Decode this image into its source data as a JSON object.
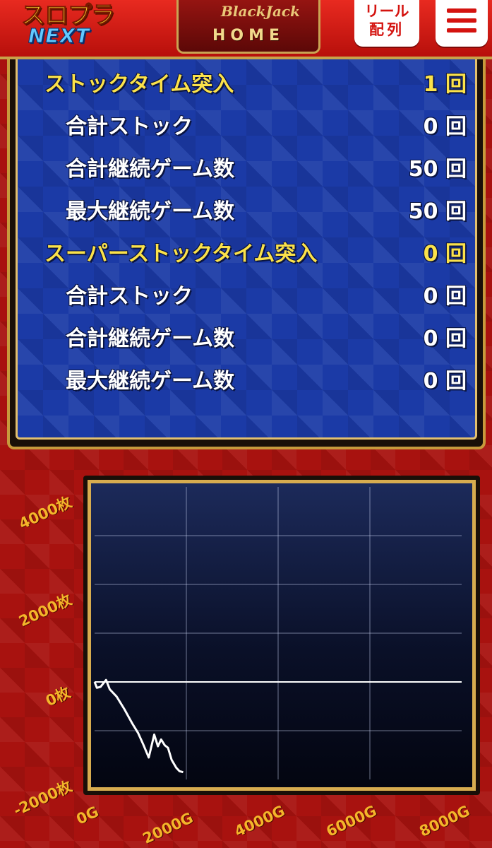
{
  "header": {
    "logo": {
      "top": "スロプラ",
      "bottom": "NEXT"
    },
    "home": {
      "emblem": "BlackJack",
      "label": "HOME"
    },
    "reel_button": {
      "line1": "リール",
      "line2": "配列"
    },
    "menu_icon": "hamburger-menu-icon"
  },
  "stats": [
    {
      "label": "ストックタイム突入",
      "value": "1 回",
      "level": "main"
    },
    {
      "label": "合計ストック",
      "value": "0 回",
      "level": "sub"
    },
    {
      "label": "合計継続ゲーム数",
      "value": "50 回",
      "level": "sub"
    },
    {
      "label": "最大継続ゲーム数",
      "value": "50 回",
      "level": "sub"
    },
    {
      "label": "スーパーストックタイム突入",
      "value": "0 回",
      "level": "main"
    },
    {
      "label": "合計ストック",
      "value": "0 回",
      "level": "sub"
    },
    {
      "label": "合計継続ゲーム数",
      "value": "0 回",
      "level": "sub"
    },
    {
      "label": "最大継続ゲーム数",
      "value": "0 回",
      "level": "sub"
    }
  ],
  "colors": {
    "header_red": "#d41a13",
    "panel_blue": "#1b3aa6",
    "gold": "#d7ac4f",
    "main_text": "#fbe24a",
    "axis_label": "#f4b52a"
  },
  "chart_data": {
    "type": "line",
    "y_tick_labels": [
      "4000枚",
      "2000枚",
      "0枚",
      "-2000枚"
    ],
    "x_tick_labels": [
      "0G",
      "2000G",
      "4000G",
      "6000G",
      "8000G"
    ],
    "ylim": [
      -2000,
      4000
    ],
    "xlim": [
      0,
      8000
    ],
    "grid": true,
    "series": [
      {
        "points": [
          [
            0,
            0
          ],
          [
            50,
            -120
          ],
          [
            130,
            -100
          ],
          [
            250,
            40
          ],
          [
            330,
            -150
          ],
          [
            480,
            -300
          ],
          [
            650,
            -560
          ],
          [
            820,
            -850
          ],
          [
            950,
            -1050
          ],
          [
            1060,
            -1280
          ],
          [
            1180,
            -1550
          ],
          [
            1300,
            -1080
          ],
          [
            1380,
            -1320
          ],
          [
            1450,
            -1180
          ],
          [
            1530,
            -1300
          ],
          [
            1600,
            -1350
          ],
          [
            1680,
            -1600
          ],
          [
            1780,
            -1760
          ],
          [
            1850,
            -1830
          ],
          [
            1930,
            -1850
          ]
        ]
      }
    ]
  }
}
